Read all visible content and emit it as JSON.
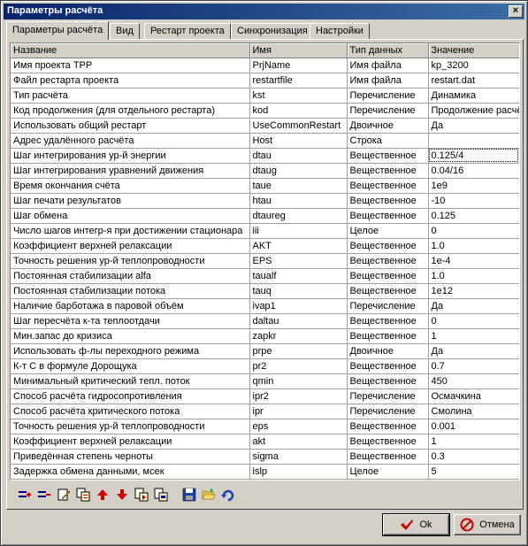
{
  "window": {
    "title": "Параметры расчёта",
    "close_label": "×"
  },
  "tabs": [
    {
      "label": "Параметры расчёта",
      "active": true
    },
    {
      "label": "Вид"
    },
    {
      "label": "Рестарт проекта"
    },
    {
      "label": "Синхронизация"
    },
    {
      "label": "Настройки"
    }
  ],
  "table": {
    "headers": [
      "Название",
      "Имя",
      "Тип данных",
      "Значение"
    ],
    "rows": [
      [
        "Имя проекта ТРР",
        "PrjName",
        "Имя файла",
        "kp_3200"
      ],
      [
        "Файл рестарта проекта",
        "restartfile",
        "Имя файла",
        "restart.dat"
      ],
      [
        "Тип расчёта",
        "kst",
        "Перечисление",
        "Динамика"
      ],
      [
        "Код продолжения (для отдельного рестарта)",
        "kod",
        "Перечисление",
        "Продолжение расчёта"
      ],
      [
        "Использовать общий рестарт",
        "UseCommonRestart",
        "Двоичное",
        "Да"
      ],
      [
        "Адрес удалённого расчёта",
        "Host",
        "Строка",
        ""
      ],
      [
        "Шаг интегрирования ур-й энергии",
        "dtau",
        "Вещественное",
        "0.125/4"
      ],
      [
        "Шаг интегрирования уравнений движения",
        "dtaug",
        "Вещественное",
        "0.04/16"
      ],
      [
        "Время окончания счёта",
        "taue",
        "Вещественное",
        "1e9"
      ],
      [
        "Шаг печати результатов",
        "htau",
        "Вещественное",
        "-10"
      ],
      [
        "Шаг обмена",
        "dtaureg",
        "Вещественное",
        "0.125"
      ],
      [
        "Число шагов интегр-я при достижении стационара",
        "iii",
        "Целое",
        "0"
      ],
      [
        "Коэффициент верхней релаксации",
        "AKT",
        "Вещественное",
        "1.0"
      ],
      [
        "Точность решения ур-й теплопроводности",
        "EPS",
        "Вещественное",
        "1e-4"
      ],
      [
        "Постоянная стабилизации alfa",
        "taualf",
        "Вещественное",
        "1.0"
      ],
      [
        "Постоянная стабилизации потока",
        "tauq",
        "Вещественное",
        "1e12"
      ],
      [
        "Наличие барботажа в паровой объём",
        "ivap1",
        "Перечисление",
        "Да"
      ],
      [
        "Шаг пересчёта к-та теплоотдачи",
        "daltau",
        "Вещественное",
        "0"
      ],
      [
        "Мин.запас до кризиса",
        "zapkr",
        "Вещественное",
        "1"
      ],
      [
        "Использовать ф-лы переходного режима",
        "prpe",
        "Двоичное",
        "Да"
      ],
      [
        "К-т С в формуле Дорощука",
        "pr2",
        "Вещественное",
        "0.7"
      ],
      [
        "Минимальный критический тепл. поток",
        "qmin",
        "Вещественное",
        "450"
      ],
      [
        "Способ расчёта гидросопротивления",
        "ipr2",
        "Перечисление",
        "Осмачкина"
      ],
      [
        "Способ расчёта критического потока",
        "ipr",
        "Перечисление",
        "Смолина"
      ],
      [
        "Точность решения ур-й теплопроводности",
        "eps",
        "Вещественное",
        "0.001"
      ],
      [
        "Коэффициент верхней релаксации",
        "akt",
        "Вещественное",
        "1"
      ],
      [
        "Приведённая степень черноты",
        "sigma",
        "Вещественное",
        "0.3"
      ],
      [
        "Задержка обмена данными, мсек",
        "islp",
        "Целое",
        "5"
      ]
    ],
    "selected": {
      "row": 6,
      "col": 3
    }
  },
  "toolbar": {
    "icons": [
      "add-row-icon",
      "remove-row-icon",
      "edit-icon",
      "copy-icon",
      "move-up-icon",
      "move-down-icon",
      "import-icon",
      "export-icon",
      "save-icon",
      "open-folder-icon",
      "refresh-icon"
    ]
  },
  "buttons": {
    "ok_label": "Ok",
    "cancel_label": "Отмена"
  },
  "colors": {
    "titlebar_start": "#0a246a",
    "titlebar_end": "#3a6ea5",
    "face": "#d4d0c8",
    "ok_check": "#cc0000",
    "cancel_icon": "#cc0000"
  }
}
